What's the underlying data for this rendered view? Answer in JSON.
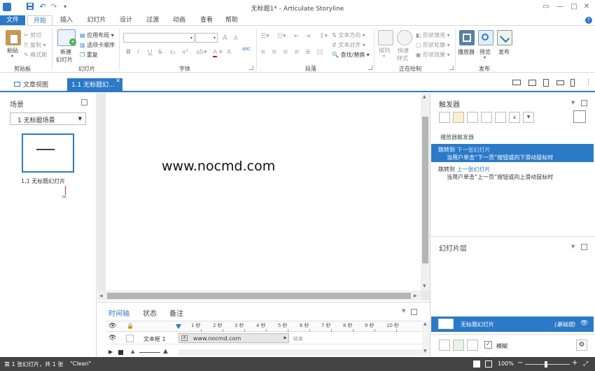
{
  "window": {
    "title": "无标题1* - Articulate Storyline"
  },
  "menu": {
    "file": "文件",
    "tabs": [
      "开始",
      "插入",
      "幻灯片",
      "设计",
      "过渡",
      "动画",
      "查看",
      "帮助"
    ]
  },
  "ribbon": {
    "clipboard": {
      "paste": "粘贴",
      "cut": "剪切",
      "copy": "复制",
      "format_painter": "格式刷",
      "label": "剪贴板"
    },
    "slides": {
      "new_slide": "新建",
      "new_slide_line2": "幻灯片",
      "apply_layout": "应用布局",
      "tab_order": "选项卡顺序",
      "duplicate": "重复",
      "label": "幻灯片"
    },
    "font": {
      "label": "字体",
      "bold": "B",
      "italic": "I",
      "underline": "U",
      "strike": "S",
      "grow": "A",
      "shrink": "A",
      "color": "A",
      "clear": "A",
      "spell": "ABC"
    },
    "paragraph": {
      "text_direction": "文本方向",
      "text_align": "文本对齐",
      "find_replace": "查找/替换",
      "label": "段落"
    },
    "drawing": {
      "arrange": "排列",
      "quick_styles": "快速",
      "quick_styles_line2": "样式",
      "shape_fill": "形状填充",
      "shape_outline": "形状轮廓",
      "shape_effects": "形状效果",
      "label": "正在绘制"
    },
    "publish": {
      "player": "播放器",
      "preview": "预览",
      "publish": "发布",
      "label": "发布"
    }
  },
  "viewbar": {
    "story_view": "文章视图",
    "active_tab": "1.1 无标题幻..."
  },
  "scenes": {
    "title": "场景",
    "selected_scene": "1 无标题场景",
    "slide_label": "1.1 无标题幻灯片"
  },
  "slide": {
    "text": "www.nocmd.com"
  },
  "timeline": {
    "tabs": [
      "时间轴",
      "状态",
      "备注"
    ],
    "ticks": [
      "1 秒",
      "2 秒",
      "3 秒",
      "4 秒",
      "5 秒",
      "6 秒",
      "7 秒",
      "8 秒",
      "9 秒",
      "10 秒"
    ],
    "row_name": "文本框 1",
    "row_content": "www.nocmd.com",
    "row_end": "结束"
  },
  "triggers": {
    "title": "触发器",
    "section": "播放器触发器",
    "items": [
      {
        "action": "跳转到",
        "target": "下一张幻灯片",
        "condition": "当用户单击“下一页”按钮或向下滑动鼠标时"
      },
      {
        "action": "跳转到",
        "target": "上一张幻灯片",
        "condition": "当用户单击“上一页”按钮或向上滑动鼠标时"
      }
    ]
  },
  "layers": {
    "title": "幻灯片层",
    "base_layer": "无标题幻灯片",
    "base_tag": "(基础层)",
    "dim_label": "模糊"
  },
  "status": {
    "slide_info": "第 1 张幻灯片，共 1 张",
    "theme": "\"Clean\"",
    "zoom": "100%"
  },
  "colors": {
    "accent": "#2b7ac8",
    "status_bg": "#444444"
  }
}
